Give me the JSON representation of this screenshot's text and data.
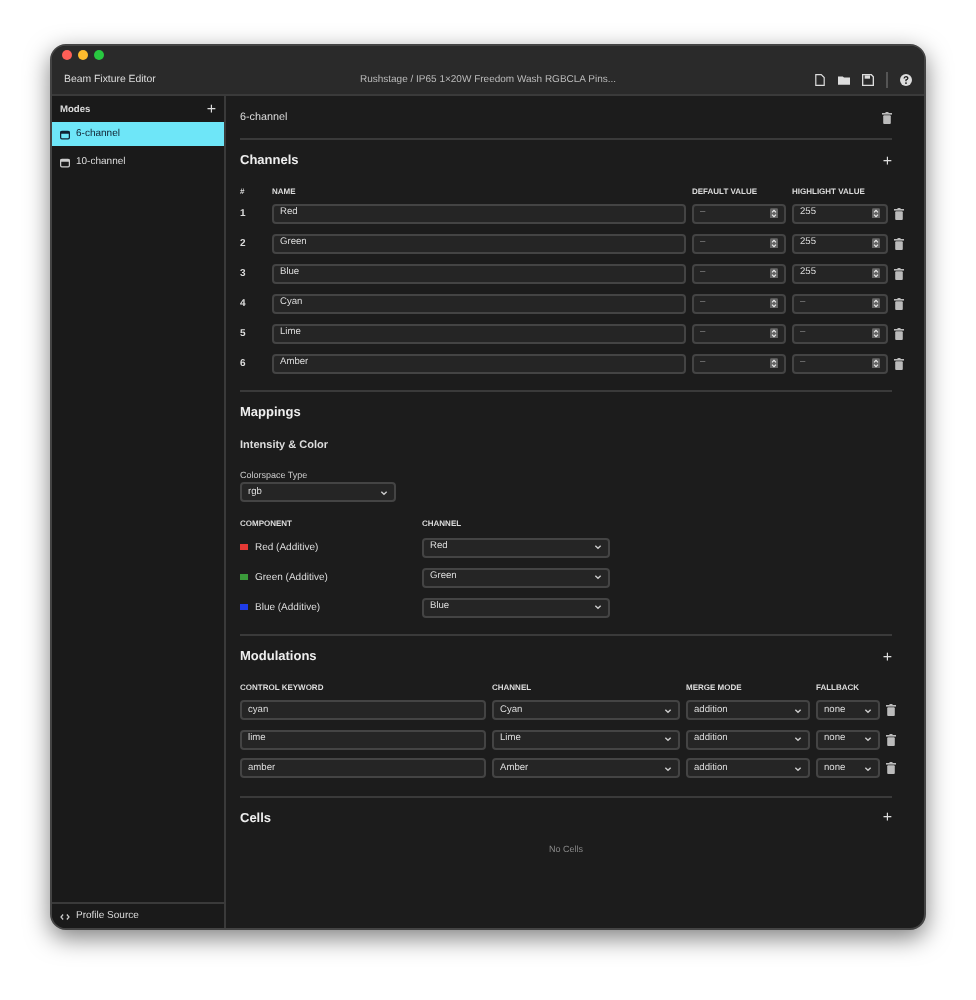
{
  "window": {
    "title": "Beam Fixture Editor",
    "path": "Rushstage / IP65 1×20W Freedom Wash RGBCLA Pins..."
  },
  "sidebar": {
    "header": "Modes",
    "add": "+",
    "items": [
      {
        "label": "6-channel",
        "selected": true
      },
      {
        "label": "10-channel",
        "selected": false
      }
    ],
    "footer": "Profile Source"
  },
  "mode": {
    "name": "6-channel"
  },
  "channels": {
    "title": "Channels",
    "add": "+",
    "columns": [
      "#",
      "NAME",
      "DEFAULT VALUE",
      "HIGHLIGHT VALUE"
    ],
    "rows": [
      {
        "index": "1",
        "name": "Red",
        "default": {
          "placeholder": "–"
        },
        "highlight": {
          "value": "255"
        }
      },
      {
        "index": "2",
        "name": "Green",
        "default": {
          "placeholder": "–"
        },
        "highlight": {
          "value": "255"
        }
      },
      {
        "index": "3",
        "name": "Blue",
        "default": {
          "placeholder": "–"
        },
        "highlight": {
          "value": "255"
        }
      },
      {
        "index": "4",
        "name": "Cyan",
        "default": {
          "placeholder": "–"
        },
        "highlight": {
          "placeholder": "–"
        }
      },
      {
        "index": "5",
        "name": "Lime",
        "default": {
          "placeholder": "–"
        },
        "highlight": {
          "placeholder": "–"
        }
      },
      {
        "index": "6",
        "name": "Amber",
        "default": {
          "placeholder": "–"
        },
        "highlight": {
          "placeholder": "–"
        }
      }
    ]
  },
  "mappings": {
    "title": "Mappings",
    "subtitle": "Intensity & Color",
    "colorspace_label": "Colorspace Type",
    "colorspace": "rgb",
    "columns": [
      "COMPONENT",
      "CHANNEL"
    ],
    "rows": [
      {
        "component": "Red (Additive)",
        "color": "#e53935",
        "channel": "Red"
      },
      {
        "component": "Green (Additive)",
        "color": "#3a9a3a",
        "channel": "Green"
      },
      {
        "component": "Blue (Additive)",
        "color": "#1e3ce8",
        "channel": "Blue"
      }
    ]
  },
  "modulations": {
    "title": "Modulations",
    "add": "+",
    "columns": [
      "CONTROL KEYWORD",
      "CHANNEL",
      "MERGE MODE",
      "FALLBACK"
    ],
    "rows": [
      {
        "keyword": "cyan",
        "channel": "Cyan",
        "merge": "addition",
        "fallback": "none"
      },
      {
        "keyword": "lime",
        "channel": "Lime",
        "merge": "addition",
        "fallback": "none"
      },
      {
        "keyword": "amber",
        "channel": "Amber",
        "merge": "addition",
        "fallback": "none"
      }
    ]
  },
  "cells": {
    "title": "Cells",
    "add": "+",
    "empty": "No Cells"
  }
}
